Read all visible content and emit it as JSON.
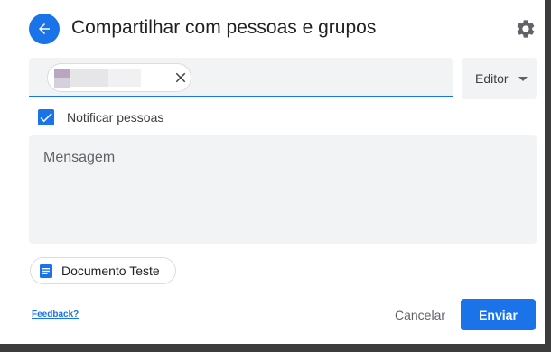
{
  "dialog": {
    "title": "Compartilhar com pessoas e grupos",
    "back_icon": "arrow-back-icon",
    "settings_icon": "gear-icon"
  },
  "recipients": {
    "chips": [
      {
        "label": "",
        "redacted": true,
        "remove_icon": "close-icon"
      }
    ]
  },
  "role": {
    "selected": "Editor",
    "icon": "caret-down-icon"
  },
  "notify": {
    "label": "Notificar pessoas",
    "checked": true
  },
  "message": {
    "placeholder": "Mensagem"
  },
  "attachment": {
    "label": "Documento Teste",
    "icon": "google-docs-icon"
  },
  "footer": {
    "feedback_label": "Feedback?",
    "cancel_label": "Cancelar",
    "send_label": "Enviar"
  },
  "colors": {
    "accent": "#1a73e8",
    "field_bg": "#f1f3f4",
    "shadow": "#3c3c3c"
  }
}
